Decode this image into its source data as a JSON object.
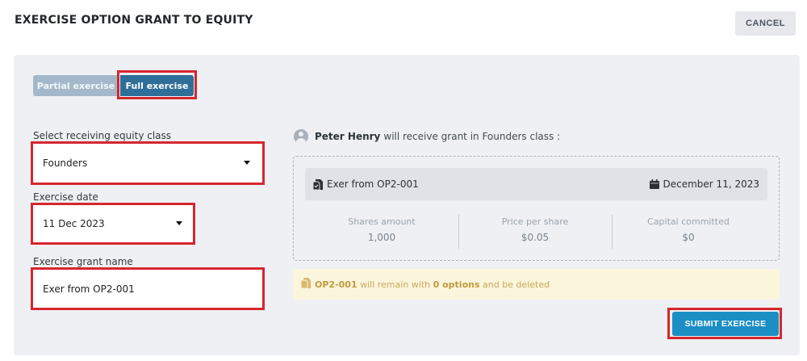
{
  "header": {
    "title": "EXERCISE OPTION GRANT TO EQUITY",
    "cancel_label": "CANCEL"
  },
  "toggle": {
    "partial_label": "Partial exercise",
    "full_label": "Full exercise",
    "selected": "Full exercise"
  },
  "form": {
    "equity_class": {
      "label": "Select receiving equity class",
      "value": "Founders"
    },
    "exercise_date": {
      "label": "Exercise date",
      "value": "11 Dec 2023"
    },
    "grant_name": {
      "label": "Exercise grant name",
      "value": "Exer from OP2-001"
    }
  },
  "summary": {
    "recipient_name": "Peter Henry",
    "recipient_text": "will receive grant in Founders class :",
    "grant_title": "Exer from OP2-001",
    "grant_date": "December 11, 2023",
    "stats": [
      {
        "label": "Shares amount",
        "value": "1,000"
      },
      {
        "label": "Price per share",
        "value": "$0.05"
      },
      {
        "label": "Capital committed",
        "value": "$0"
      }
    ]
  },
  "notice": {
    "code": "OP2-001",
    "text_before": "will remain with",
    "options": "0 options",
    "text_after": "and be deleted"
  },
  "actions": {
    "submit_label": "SUBMIT EXERCISE"
  },
  "colors": {
    "primary": "#2f6e99",
    "submit": "#1b8ec4",
    "highlight": "#d7262e",
    "notice_bg": "#fbf5dc",
    "notice_text": "#c9a95a"
  }
}
